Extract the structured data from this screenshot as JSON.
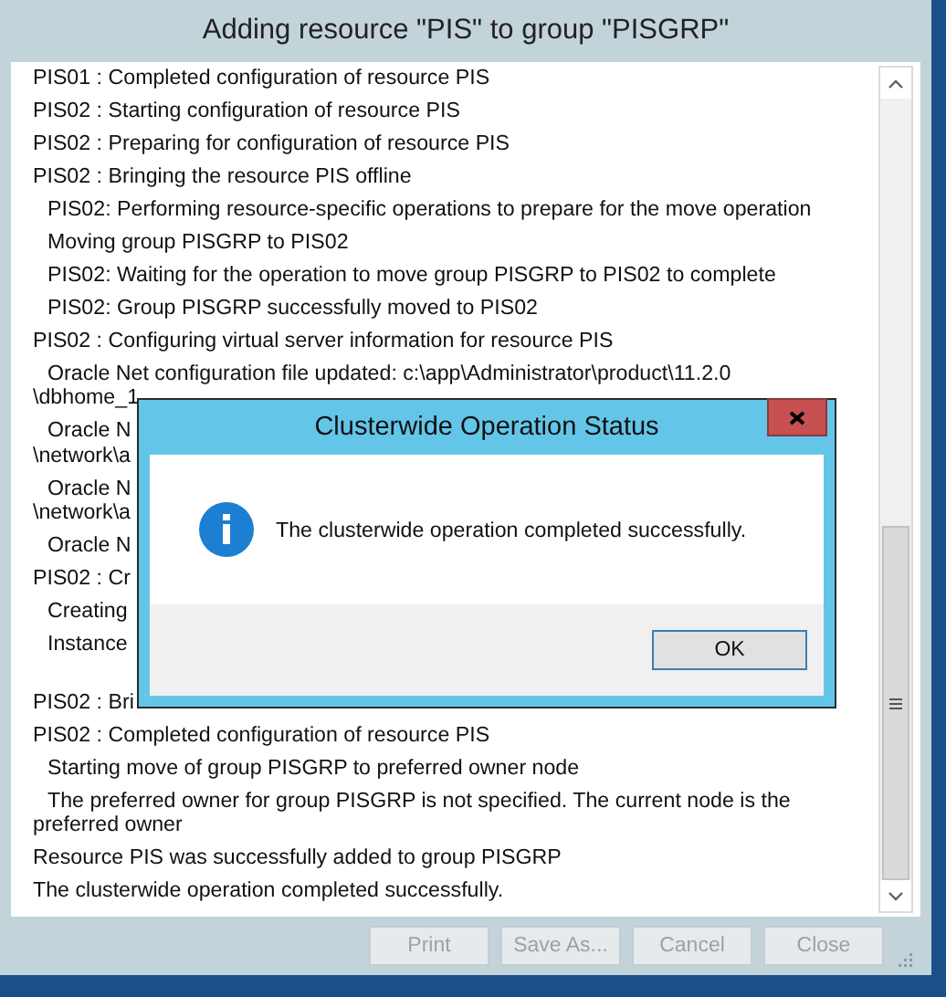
{
  "window": {
    "title": "Adding resource \"PIS\" to group \"PISGRP\""
  },
  "log": [
    {
      "lines": [
        "PIS01 : Completed configuration of resource PIS"
      ]
    },
    {
      "lines": [
        "PIS02 : Starting configuration of resource PIS"
      ]
    },
    {
      "lines": [
        "PIS02 : Preparing for configuration of resource PIS"
      ]
    },
    {
      "lines": [
        "PIS02 : Bringing the resource PIS offline"
      ],
      "children": [
        {
          "lines": [
            "PIS02: Performing resource-specific operations to prepare for the move operation"
          ]
        },
        {
          "lines": [
            "Moving group PISGRP to PIS02"
          ]
        },
        {
          "lines": [
            "PIS02: Waiting for the operation to move group PISGRP to PIS02 to complete"
          ]
        },
        {
          "lines": [
            "PIS02: Group PISGRP successfully moved to PIS02"
          ]
        }
      ]
    },
    {
      "lines": [
        "PIS02 : Configuring virtual server information for resource PIS"
      ],
      "children": [
        {
          "lines": [
            "Oracle Net configuration file updated: c:\\app\\Administrator\\product\\11.2.0",
            "\\dbhome_1"
          ]
        },
        {
          "lines": [
            "Oracle N",
            "\\network\\a"
          ]
        },
        {
          "lines": [
            "Oracle N",
            "\\network\\a"
          ]
        },
        {
          "lines": [
            "Oracle N"
          ]
        }
      ]
    },
    {
      "lines": [
        "PIS02 : Cr"
      ],
      "children": [
        {
          "lines": [
            "Creating"
          ]
        },
        {
          "lines": [
            "Instance"
          ]
        }
      ]
    },
    {
      "lines": [
        "PIS02 : Bri"
      ],
      "gap_before": true
    },
    {
      "lines": [
        "PIS02 : Completed configuration of resource PIS"
      ],
      "children": [
        {
          "lines": [
            "Starting move of group PISGRP to preferred owner node"
          ]
        },
        {
          "lines": [
            "The preferred owner for group PISGRP is not specified. The current node is the",
            "preferred owner"
          ]
        }
      ]
    },
    {
      "lines": [
        "Resource PIS was successfully added to group PISGRP"
      ]
    },
    {
      "lines": [
        "The clusterwide operation completed successfully."
      ]
    }
  ],
  "buttons": [
    {
      "label": "Print",
      "disabled": true
    },
    {
      "label": "Save As...",
      "disabled": true
    },
    {
      "label": "Cancel",
      "disabled": true
    },
    {
      "label": "Close",
      "disabled": true
    }
  ],
  "dialog": {
    "title": "Clusterwide Operation Status",
    "message": "The clusterwide operation completed successfully.",
    "buttons": [
      {
        "label": "OK"
      }
    ]
  }
}
